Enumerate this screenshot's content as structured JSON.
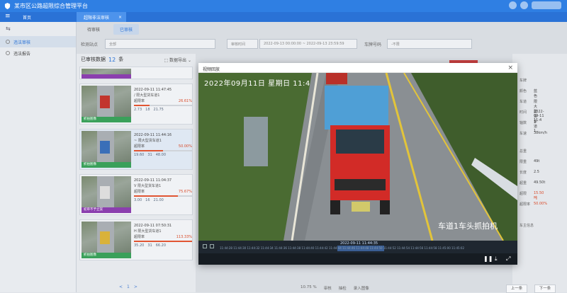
{
  "app": {
    "title": "某市区公路超限综合管理平台"
  },
  "tabs": [
    {
      "label": "首页"
    },
    {
      "label": "超限非法审核"
    }
  ],
  "sidebar": {
    "items": [
      {
        "label": "违法审核"
      },
      {
        "label": "违法报告"
      }
    ]
  },
  "subtabs": [
    "待审核",
    "已审核"
  ],
  "filters": {
    "site_label": "检测站点",
    "site_value": "全部",
    "time_label": "审核时间",
    "time_range": "2022-09-13 00:00:00  ~  2022-09-13 23:59:59",
    "plate_label": "车牌号码",
    "plate_value": "-不限"
  },
  "list": {
    "title": "已审核数据",
    "count": "12",
    "count_unit": "条",
    "export_label": "数据导出",
    "cards": [
      {
        "time": "2022-09-11 11:47:45",
        "desc": "/ 限大型货车道1",
        "pct_label": "超限率",
        "pct": "26.61%",
        "fill": 0.27,
        "tag": "抓拍图像",
        "tag_color": "green",
        "s1": "2.73",
        "s2": "18",
        "s3": "21.75"
      },
      {
        "time": "2022-09-11 11:44:16",
        "desc": "~ 限大型货车道1",
        "pct_label": "超限率",
        "pct": "50.00%",
        "fill": 0.5,
        "tag": "抓拍图像",
        "tag_color": "green",
        "s1": "19.60",
        "s2": "31",
        "s3": "48.00"
      },
      {
        "time": "2022-09-11 11:04:37",
        "desc": "V 限大型货车道1",
        "pct_label": "超限率",
        "pct": "75.67%",
        "fill": 0.76,
        "tag": "初审不予立案",
        "tag_color": "purple",
        "s1": "3.00",
        "s2": "16",
        "s3": "21.00"
      },
      {
        "time": "2022-09-11 07:50:31",
        "desc": "H 限大型货车道1",
        "pct_label": "超限率",
        "pct": "113.33%",
        "fill": 1.0,
        "tag": "抓拍图像",
        "tag_color": "green",
        "s1": "35.20",
        "s2": "31",
        "s3": "66.20"
      }
    ],
    "pager": [
      "<",
      "1",
      ">"
    ]
  },
  "modal": {
    "title": "视频回放",
    "osd_top": "2022年09月11日  星期日  11:4",
    "osd_bottom": "车道1车头抓拍机",
    "timeline_stamp": "2022-09-11 11:44:35",
    "ticks": "11:44:28 11:44:30 11:44:32 11:44:34 11:44:36 11:44:38 11:44:40 11:44:42 11:44:44 11:44:46 11:44:48 11:44:50 11:44:52 11:44:54 11:44:56 11:44:58 11:45:00 11:45:02"
  },
  "right_panel": {
    "rows": [
      {
        "k": "车牌",
        "v": ""
      },
      {
        "k": "颜色",
        "v": "蓝色"
      },
      {
        "k": "车道",
        "v": "限大型货车道1"
      },
      {
        "k": "时间",
        "v": "2022-09-11 11:4"
      },
      {
        "k": "轴数",
        "v": "1"
      },
      {
        "k": "车速",
        "v": "38km/h"
      },
      {
        "k": "总重",
        "v": ""
      },
      {
        "k": "限重",
        "v": "49t"
      },
      {
        "k": "长度",
        "v": "2.5"
      },
      {
        "k": "超重",
        "v": "49.50t"
      },
      {
        "k": "超限",
        "v": "15.50吨",
        "red": true
      },
      {
        "k": "超限率",
        "v": "50.00%",
        "red": true
      },
      {
        "k": "车主信息",
        "v": ""
      }
    ],
    "prev": "上一条",
    "next": "下一条"
  },
  "bottom_stats": [
    "10.75  %",
    "审核",
    "抽检",
    "录入图像"
  ]
}
